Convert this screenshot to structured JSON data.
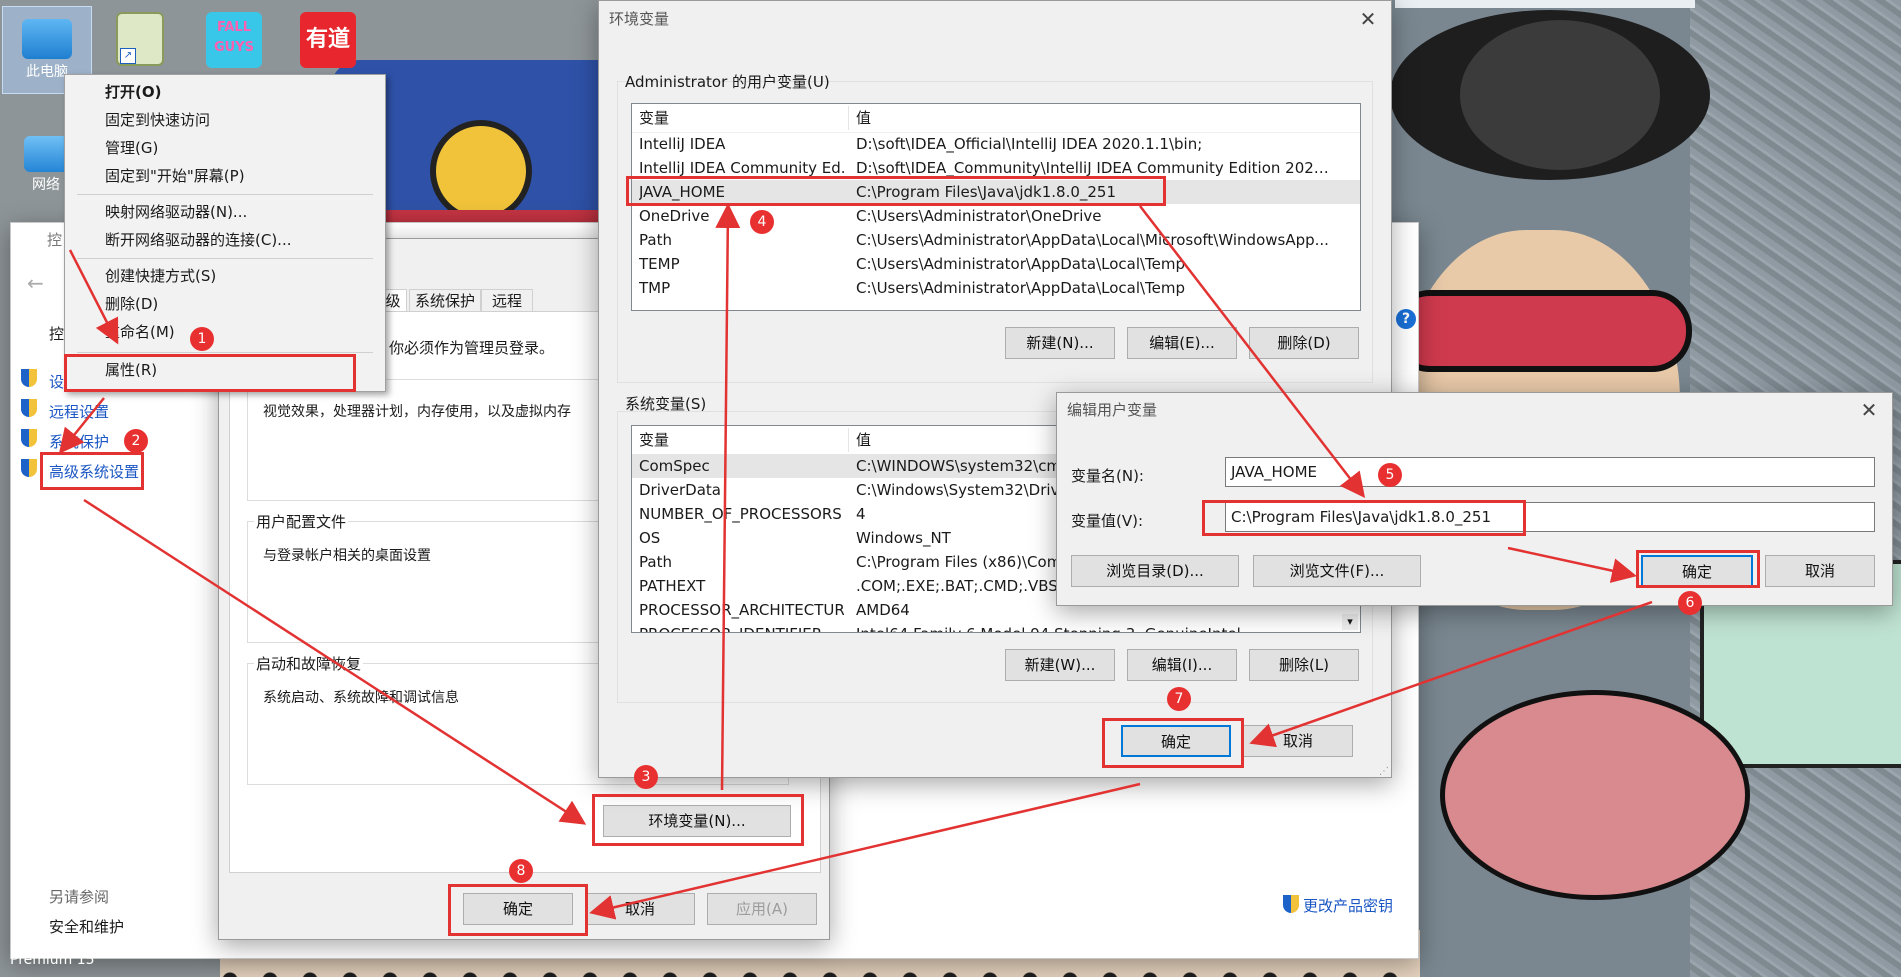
{
  "desktop": {
    "icons": [
      {
        "label": "此电脑",
        "icon": "computer-icon"
      },
      {
        "label": "",
        "icon": "notepad-shortcut-icon"
      },
      {
        "label": "",
        "icon": "fall-guys-shortcut-icon"
      },
      {
        "label": "",
        "icon": "youdao-shortcut-icon"
      },
      {
        "label": "网络",
        "icon": "network-icon"
      }
    ],
    "logo_texts": {
      "fall_guys": "FALL GUYS",
      "youdao": "有道"
    },
    "bottom_left_text": "Premium 15"
  },
  "context_menu": {
    "items": [
      {
        "label": "打开(O)"
      },
      {
        "label": "固定到快速访问"
      },
      {
        "label": "管理(G)"
      },
      {
        "label": "固定到\"开始\"屏幕(P)"
      },
      {
        "label": "映射网络驱动器(N)..."
      },
      {
        "label": "断开网络驱动器的连接(C)..."
      },
      {
        "label": "创建快捷方式(S)"
      },
      {
        "label": "删除(D)"
      },
      {
        "label": "重命名(M)"
      },
      {
        "label": "属性(R)"
      }
    ]
  },
  "control_panel": {
    "title_fragment": "控",
    "header_fragment": "控",
    "links": [
      "设",
      "远程设置",
      "系统保护",
      "高级系统设置"
    ],
    "see_also_title": "另请参阅",
    "see_also_links": [
      "安全和维护"
    ],
    "change_key": "更改产品密钥"
  },
  "system_properties": {
    "tabs": [
      "级",
      "系统保护",
      "远程"
    ],
    "admin_note": "你必须作为管理员登录。",
    "perf_desc": "视觉效果，处理器计划，内存使用，以及虚拟内存",
    "profile_title": "用户配置文件",
    "profile_desc": "与登录帐户相关的桌面设置",
    "startup_title": "启动和故障恢复",
    "startup_desc": "系统启动、系统故障和调试信息",
    "env_button": "环境变量(N)...",
    "ok": "确定",
    "cancel": "取消",
    "apply": "应用(A)"
  },
  "env_vars": {
    "title": "环境变量",
    "user_section": "Administrator 的用户变量(U)",
    "col_var": "变量",
    "col_val": "值",
    "user_rows": [
      {
        "name": "IntelliJ IDEA",
        "value": "D:\\soft\\IDEA_Official\\IntelliJ IDEA 2020.1.1\\bin;"
      },
      {
        "name": "IntelliJ IDEA Community Ed...",
        "value": "D:\\soft\\IDEA_Community\\IntelliJ IDEA Community Edition 2020...."
      },
      {
        "name": "JAVA_HOME",
        "value": "C:\\Program Files\\Java\\jdk1.8.0_251"
      },
      {
        "name": "OneDrive",
        "value": "C:\\Users\\Administrator\\OneDrive"
      },
      {
        "name": "Path",
        "value": "C:\\Users\\Administrator\\AppData\\Local\\Microsoft\\WindowsApp..."
      },
      {
        "name": "TEMP",
        "value": "C:\\Users\\Administrator\\AppData\\Local\\Temp"
      },
      {
        "name": "TMP",
        "value": "C:\\Users\\Administrator\\AppData\\Local\\Temp"
      }
    ],
    "user_buttons": {
      "new": "新建(N)...",
      "edit": "编辑(E)...",
      "delete": "删除(D)"
    },
    "sys_section": "系统变量(S)",
    "sys_rows": [
      {
        "name": "ComSpec",
        "value": "C:\\WINDOWS\\system32\\cm"
      },
      {
        "name": "DriverData",
        "value": "C:\\Windows\\System32\\Driv"
      },
      {
        "name": "NUMBER_OF_PROCESSORS",
        "value": "4"
      },
      {
        "name": "OS",
        "value": "Windows_NT"
      },
      {
        "name": "Path",
        "value": "C:\\Program Files (x86)\\Com"
      },
      {
        "name": "PATHEXT",
        "value": ".COM;.EXE;.BAT;.CMD;.VBS;."
      },
      {
        "name": "PROCESSOR_ARCHITECTURE",
        "value": "AMD64"
      },
      {
        "name": "PROCESSOR_IDENTIFIER",
        "value": "Intel64 Family 6 Model 94 Stepping 3, GenuineIntel"
      }
    ],
    "sys_buttons": {
      "new": "新建(W)...",
      "edit": "编辑(I)...",
      "delete": "删除(L)"
    },
    "ok": "确定",
    "cancel": "取消"
  },
  "edit_var": {
    "title": "编辑用户变量",
    "name_label": "变量名(N):",
    "name_value": "JAVA_HOME",
    "value_label": "变量值(V):",
    "value_value": "C:\\Program Files\\Java\\jdk1.8.0_251",
    "browse_dir": "浏览目录(D)...",
    "browse_file": "浏览文件(F)...",
    "ok": "确定",
    "cancel": "取消"
  },
  "annotations": {
    "steps": [
      "1",
      "2",
      "3",
      "4",
      "5",
      "6",
      "7",
      "8"
    ],
    "color": "#e23232"
  },
  "colors": {
    "accent": "#0078d7",
    "link": "#1a56c4",
    "annotation": "#e23232"
  }
}
